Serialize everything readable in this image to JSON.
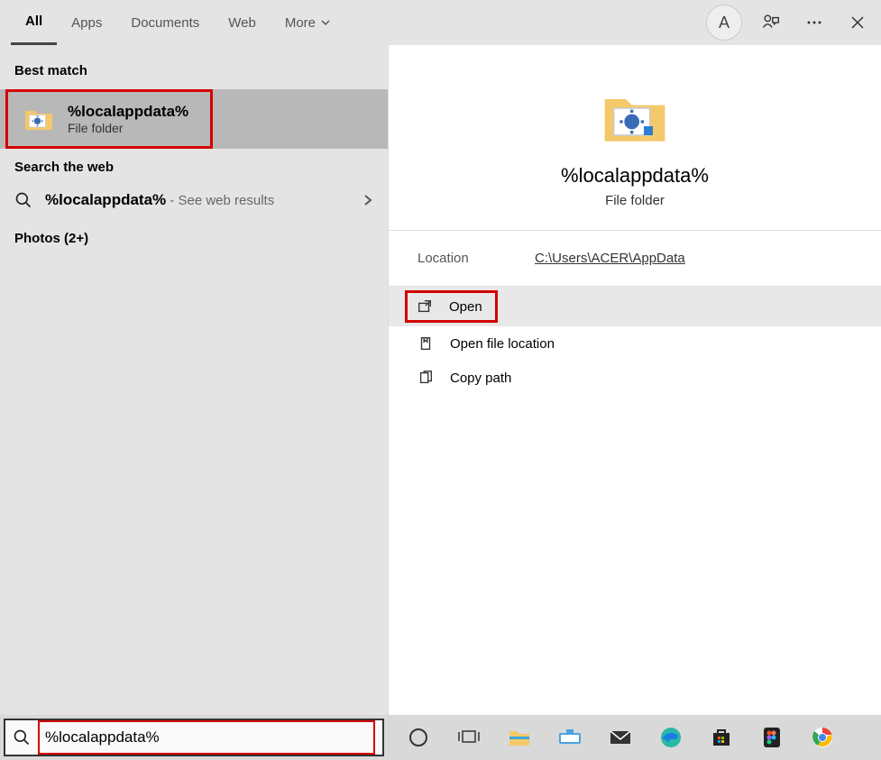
{
  "tabs": {
    "all": "All",
    "apps": "Apps",
    "documents": "Documents",
    "web": "Web",
    "more": "More"
  },
  "avatar_initial": "A",
  "left": {
    "best_match_header": "Best match",
    "best_match": {
      "title": "%localappdata%",
      "subtitle": "File folder"
    },
    "web_header": "Search the web",
    "web_item": {
      "query": "%localappdata%",
      "hint": " - See web results"
    },
    "photos_header": "Photos (2+)"
  },
  "right": {
    "title": "%localappdata%",
    "subtitle": "File folder",
    "location_label": "Location",
    "location_path": "C:\\Users\\ACER\\AppData",
    "actions": {
      "open": "Open",
      "open_location": "Open file location",
      "copy_path": "Copy path"
    }
  },
  "search_value": "%localappdata%"
}
